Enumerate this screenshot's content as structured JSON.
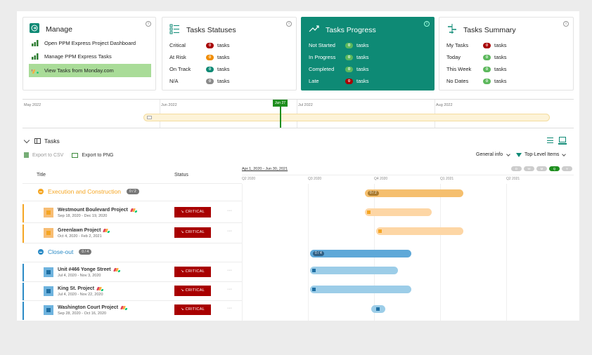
{
  "manage": {
    "title": "Manage",
    "items": [
      {
        "label": "Open PPM Express Project Dashboard"
      },
      {
        "label": "Manage PPM Express Tasks"
      },
      {
        "label": "View Tasks from Monday.com"
      }
    ]
  },
  "statuses": {
    "title": "Tasks Statuses",
    "rows": [
      {
        "label": "Critical",
        "count": "0",
        "suffix": "tasks",
        "color": "#a80000"
      },
      {
        "label": "At Risk",
        "count": "0",
        "suffix": "tasks",
        "color": "#f08c00"
      },
      {
        "label": "On Track",
        "count": "0",
        "suffix": "tasks",
        "color": "#0e8a75"
      },
      {
        "label": "N/A",
        "count": "0",
        "suffix": "tasks",
        "color": "#8a8a8a"
      }
    ]
  },
  "progress": {
    "title": "Tasks Progress",
    "rows": [
      {
        "label": "Not Started",
        "count": "0",
        "suffix": "tasks",
        "color": "#5cb85c"
      },
      {
        "label": "In Progress",
        "count": "0",
        "suffix": "tasks",
        "color": "#5cb85c"
      },
      {
        "label": "Completed",
        "count": "0",
        "suffix": "tasks",
        "color": "#5cb85c"
      },
      {
        "label": "Late",
        "count": "0",
        "suffix": "tasks",
        "color": "#a80000"
      }
    ]
  },
  "summary": {
    "title": "Tasks Summary",
    "rows": [
      {
        "label": "My Tasks",
        "count": "0",
        "suffix": "tasks",
        "color": "#a80000"
      },
      {
        "label": "Today",
        "count": "0",
        "suffix": "tasks",
        "color": "#5cb85c"
      },
      {
        "label": "This Week",
        "count": "0",
        "suffix": "tasks",
        "color": "#5cb85c"
      },
      {
        "label": "No Dates",
        "count": "0",
        "suffix": "tasks",
        "color": "#5cb85c"
      }
    ]
  },
  "timeline": {
    "labels": [
      "May 2022",
      "Jun 2022",
      "Jul 2022",
      "Aug 2022"
    ],
    "today_label": "Jun 27"
  },
  "tasks": {
    "header": "Tasks",
    "export_csv": "Export to CSV",
    "export_png": "Export to PNG",
    "general_info": "General info",
    "filter": "Top-Level Items",
    "col_title": "Title",
    "col_status": "Status",
    "date_range": "Apr 1, 2020 - Jun 30, 2021",
    "quarters": [
      "Q2 2020",
      "Q3 2020",
      "Q4 2020",
      "Q1 2021",
      "Q2 2021"
    ],
    "scale": [
      "D",
      "W",
      "M",
      "Q",
      "Y"
    ],
    "groups": [
      {
        "title": "Execution and Construction",
        "count": "0 / 2"
      },
      {
        "title": "Close-out",
        "count": "0 / 4"
      }
    ],
    "items": [
      {
        "name": "Westmount Boulevard Project",
        "dates": "Sep 18, 2020 - Dec 19, 2020",
        "status": "CRITICAL"
      },
      {
        "name": "Greenlawn Project",
        "dates": "Oct 4, 2020 - Feb 2, 2021",
        "status": "CRITICAL"
      },
      {
        "name": "Unit #466 Yonge Street",
        "dates": "Jul 4, 2020 - Nov 3, 2020",
        "status": "CRITICAL"
      },
      {
        "name": "King St. Project",
        "dates": "Jul 4, 2020 - Nov 22, 2020",
        "status": "CRITICAL"
      },
      {
        "name": "Washington Court Project",
        "dates": "Sep 28, 2020 - Oct 16, 2020",
        "status": "CRITICAL"
      }
    ],
    "more": "···"
  },
  "colors": {
    "accent": "#0e8a75",
    "orange": "#f5a623",
    "blue": "#2b8bc6",
    "critical": "#a80000",
    "manage_highlight": "#a9dc98"
  }
}
